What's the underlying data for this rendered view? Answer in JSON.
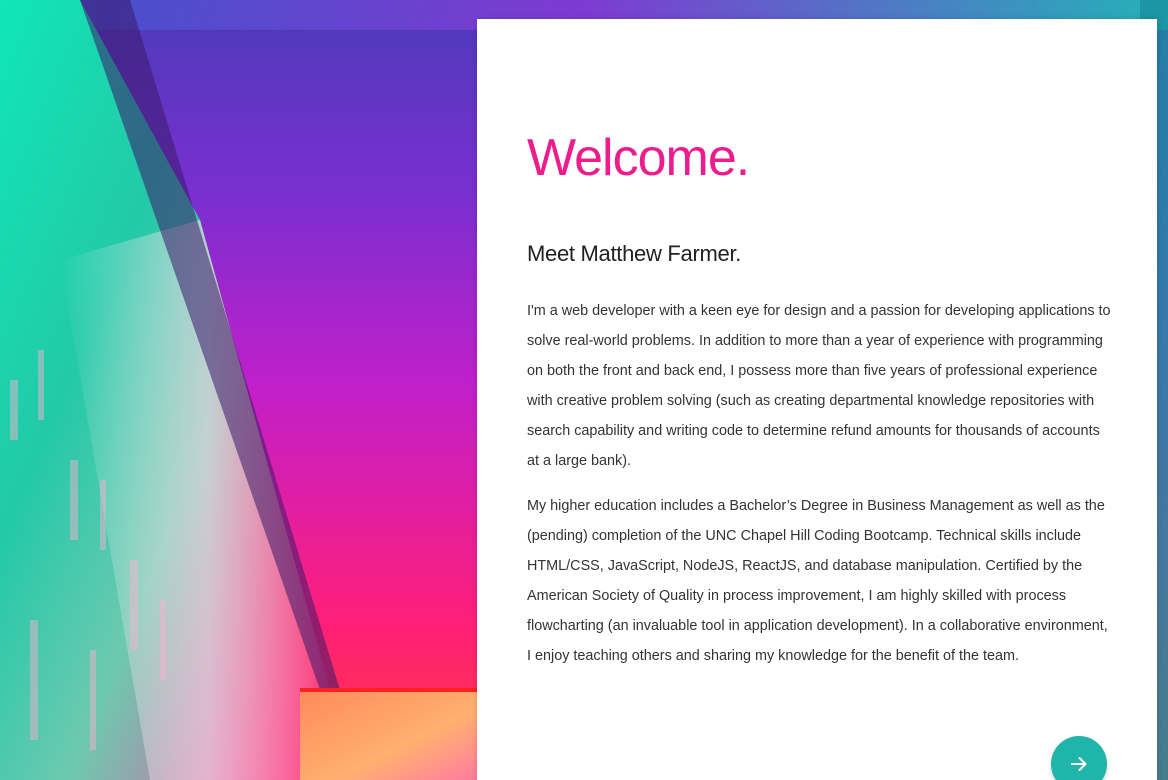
{
  "hero": {
    "welcome": "Welcome.",
    "subtitle": "Meet Matthew Farmer."
  },
  "bio": {
    "paragraph_1": "I'm a web developer with a keen eye for design and a passion for developing applications to solve real-world problems. In addition to more than a year of experience with programming on both the front and back end, I possess more than five years of professional experience with creative problem solving (such as creating departmental knowledge repositories with search capability and writing code to determine refund amounts for thousands of accounts at a large bank).",
    "paragraph_2": "My higher education includes a Bachelor’s Degree in Business Management as well as the (pending) completion of the UNC Chapel Hill Coding Bootcamp. Technical skills include HTML/CSS, JavaScript, NodeJS, ReactJS, and database manipulation. Certified by the American Society of Quality in process improvement, I am highly skilled with process flowcharting (an invaluable tool in application development). In a collaborative environment, I enjoy teaching others and sharing my knowledge for the benefit of the team."
  },
  "next_button": {
    "icon": "arrow-right-icon"
  },
  "colors": {
    "accent_pink": "#ee1c8c",
    "button_teal": "#1fb5a8"
  }
}
